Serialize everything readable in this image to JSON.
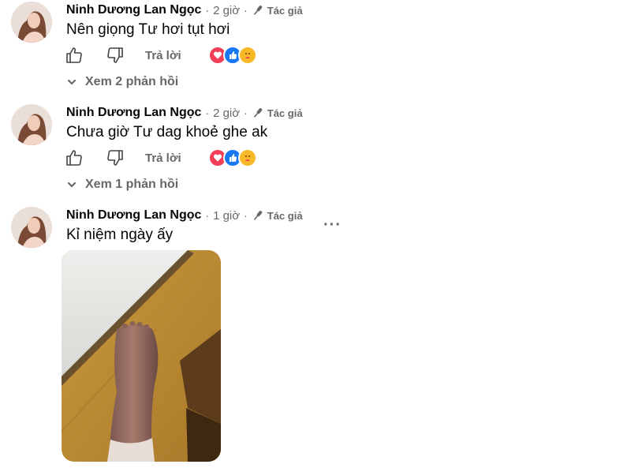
{
  "comments": [
    {
      "author": "Ninh Dương Lan Ngọc",
      "time": "2 giờ",
      "badge": "Tác giả",
      "text": "Nên giọng Tư hơi tụt hơi",
      "reply_label": "Trả lời",
      "view_replies": "Xem 2 phản hồi"
    },
    {
      "author": "Ninh Dương Lan Ngọc",
      "time": "2 giờ",
      "badge": "Tác giả",
      "text": "Chưa giờ Tư dag khoẻ ghe ak",
      "reply_label": "Trả lời",
      "view_replies": "Xem 1 phản hồi"
    },
    {
      "author": "Ninh Dương Lan Ngọc",
      "time": "1 giờ",
      "badge": "Tác giả",
      "text": "Kỉ niệm ngày ấy",
      "more": "···"
    }
  ],
  "separator": "·",
  "icons": [
    "avatar",
    "microphone-icon",
    "thumbs-up-icon",
    "thumbs-down-icon",
    "heart-reaction-icon",
    "like-reaction-icon",
    "care-reaction-icon",
    "chevron-down-icon",
    "more-options-icon"
  ],
  "colors": {
    "secondary_text": "#65676b",
    "primary_text": "#050505",
    "like_blue": "#1877f2",
    "love_red": "#f33e58",
    "care_yellow": "#f7b928"
  }
}
